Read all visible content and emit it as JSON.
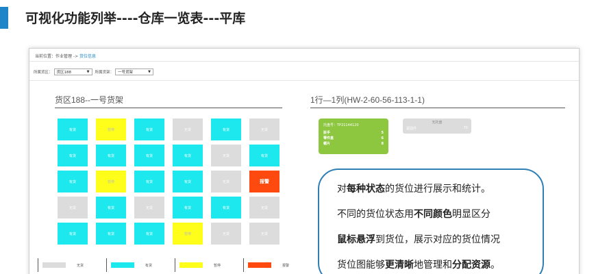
{
  "slide": {
    "title": "可视化功能列举----仓库一览表---平库"
  },
  "breadcrumb": {
    "prefix": "当前位置：",
    "path": "作业管理 -> ",
    "current": "货位信息"
  },
  "filters": {
    "area_label": "所属货区：",
    "area_value": "货区188",
    "shelf_label": "所属货架：",
    "shelf_value": "一号货架"
  },
  "left_panel": {
    "title": "货区188--一号货架"
  },
  "right_panel": {
    "title": "1行—1列(HW-2-60-56-113-1-1)"
  },
  "slot_grid": {
    "rows": [
      [
        {
          "status": "occupied",
          "label": "有货"
        },
        {
          "status": "paused",
          "label": "暂停"
        },
        {
          "status": "occupied",
          "label": "有货"
        },
        {
          "status": "empty",
          "label": "无货"
        },
        {
          "status": "occupied",
          "label": "有货"
        },
        {
          "status": "empty",
          "label": "无货"
        }
      ],
      [
        {
          "status": "occupied",
          "label": "有货"
        },
        {
          "status": "occupied",
          "label": "有货"
        },
        {
          "status": "occupied",
          "label": "有货"
        },
        {
          "status": "occupied",
          "label": "有货"
        },
        {
          "status": "empty",
          "label": "无货"
        },
        {
          "status": "occupied",
          "label": "有货"
        }
      ],
      [
        {
          "status": "occupied",
          "label": "有货"
        },
        {
          "status": "paused",
          "label": "暂停"
        },
        {
          "status": "occupied",
          "label": "有货"
        },
        {
          "status": "occupied",
          "label": "有货"
        },
        {
          "status": "empty",
          "label": "无货"
        },
        {
          "status": "alarm",
          "label": "报警"
        }
      ],
      [
        {
          "status": "empty",
          "label": "无货"
        },
        {
          "status": "occupied",
          "label": "有货"
        },
        {
          "status": "empty",
          "label": "无货"
        },
        {
          "status": "occupied",
          "label": "有货"
        },
        {
          "status": "occupied",
          "label": "有货"
        },
        {
          "status": "empty",
          "label": "无货"
        }
      ],
      [
        {
          "status": "occupied",
          "label": "有货"
        },
        {
          "status": "occupied",
          "label": "有货"
        },
        {
          "status": "occupied",
          "label": "有货"
        },
        {
          "status": "paused",
          "label": "暂停"
        },
        {
          "status": "empty",
          "label": "无货"
        },
        {
          "status": "empty",
          "label": "无货"
        }
      ]
    ]
  },
  "legend": [
    {
      "label": "无货",
      "color": "#dcdcdc"
    },
    {
      "label": "有货",
      "color": "#1de8ee"
    },
    {
      "label": "暂停",
      "color": "#fefe1a"
    },
    {
      "label": "报警",
      "color": "#fe4a0f"
    }
  ],
  "slot_detail": {
    "pallet_label": "托盘号：TP21144120",
    "items": [
      {
        "name": "扳手",
        "count": "5"
      },
      {
        "name": "零件盒",
        "count": "6"
      },
      {
        "name": "螺片",
        "count": "8"
      }
    ]
  },
  "empty_slot": {
    "title": "无托盘",
    "label": "紧固件",
    "count": "70"
  },
  "callout": {
    "l1_a": "对",
    "l1_b": "每种状态",
    "l1_c": "的货位进行展示和统计。",
    "l2_a": "不同的货位状态用",
    "l2_b": "不同颜色",
    "l2_c": "明显区分",
    "l3_a": "鼠标悬浮",
    "l3_b": "到货位，展示对应的货位情况",
    "l4_a": "货位图能够",
    "l4_b": "更清晰",
    "l4_c": "地管理和",
    "l4_d": "分配资源",
    "l4_e": "。"
  }
}
